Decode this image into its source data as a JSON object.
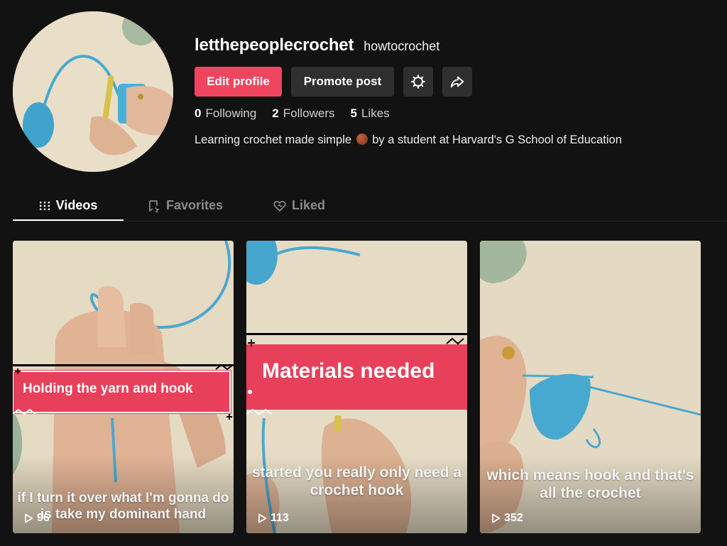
{
  "profile": {
    "username": "letthepeoplecrochet",
    "nickname": "howtocrochet",
    "bio_before": "Learning crochet made simple",
    "bio_after": "by a student at Harvard's G School of Education",
    "actions": {
      "edit": "Edit profile",
      "promote": "Promote post"
    },
    "stats": [
      {
        "value": "0",
        "label": "Following"
      },
      {
        "value": "2",
        "label": "Followers"
      },
      {
        "value": "5",
        "label": "Likes"
      }
    ]
  },
  "tabs": [
    {
      "label": "Videos",
      "icon": "grid-icon",
      "active": true
    },
    {
      "label": "Favorites",
      "icon": "bookmark-icon",
      "active": false
    },
    {
      "label": "Liked",
      "icon": "heart-icon",
      "active": false
    }
  ],
  "videos": [
    {
      "banner": "Holding the yarn and hook",
      "caption": "if I turn it over what I'm gonna do is take my dominant hand",
      "plays": "96"
    },
    {
      "banner": "Materials needed",
      "caption": "started you really only need a crochet hook",
      "plays": "113"
    },
    {
      "banner": "",
      "caption": "which means hook and that's all the crochet",
      "plays": "352"
    }
  ],
  "colors": {
    "accent": "#fe2c55",
    "background": "#121212",
    "banner": "#e8405b",
    "yarn": "#4fb3d9"
  }
}
